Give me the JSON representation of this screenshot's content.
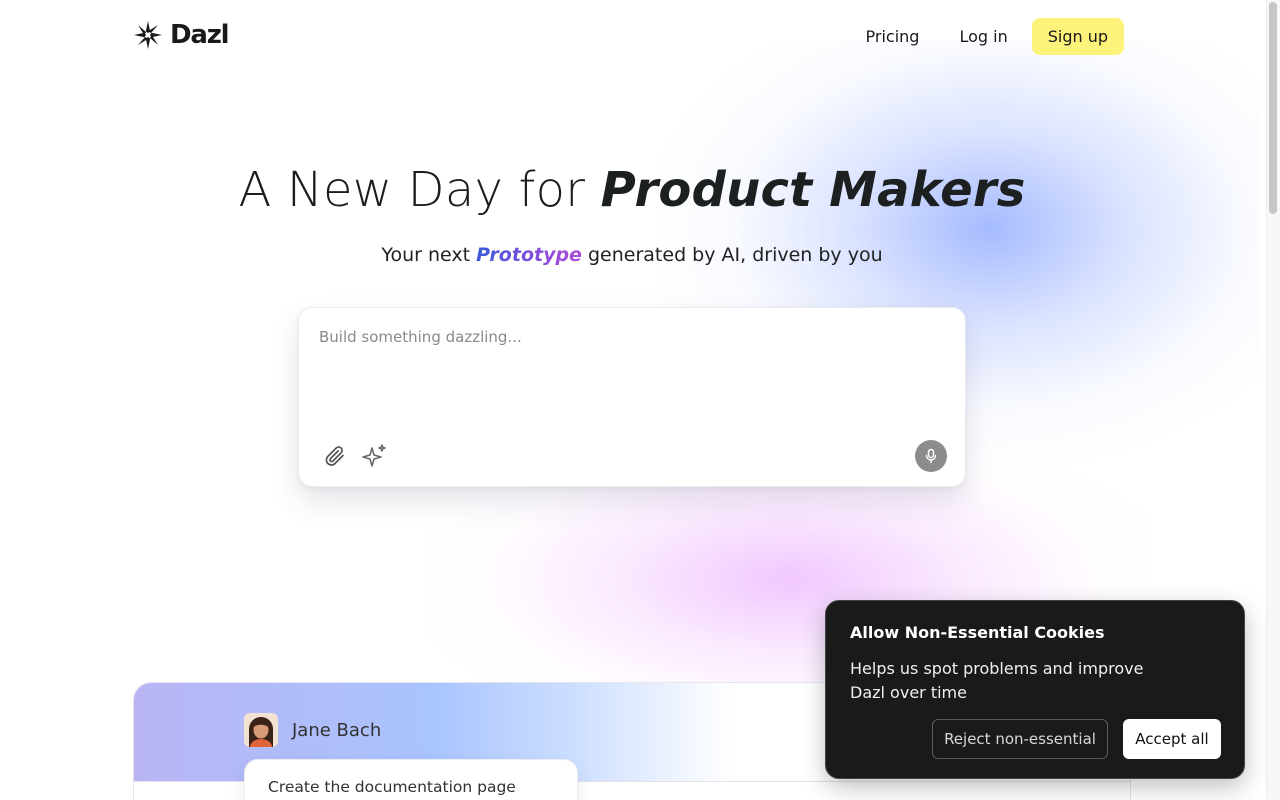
{
  "brand": {
    "name": "Dazl",
    "logo_icon": "asterisk-spark-icon"
  },
  "nav": {
    "pricing": "Pricing",
    "login": "Log in",
    "signup": "Sign up"
  },
  "hero": {
    "title_light": "A New Day for ",
    "title_bold": "Product Makers",
    "sub_before": "Your next ",
    "sub_highlight": "Prototype",
    "sub_after": " generated by AI, driven by you"
  },
  "prompt": {
    "placeholder": "Build something dazzling...",
    "attach_icon": "paperclip-icon",
    "sparkle_icon": "sparkle-icon",
    "mic_icon": "microphone-icon"
  },
  "preview": {
    "user_name": "Jane Bach",
    "message": "Create the documentation page"
  },
  "cookie": {
    "title": "Allow Non-Essential Cookies",
    "body": "Helps us spot problems and improve Dazl over time",
    "reject": "Reject non-essential",
    "accept": "Accept all"
  },
  "colors": {
    "signup_bg": "#fdf27a",
    "highlight_gradient_start": "#3b5bdb",
    "highlight_gradient_end": "#b24bd8",
    "cookie_bg": "#1a1a1a"
  }
}
